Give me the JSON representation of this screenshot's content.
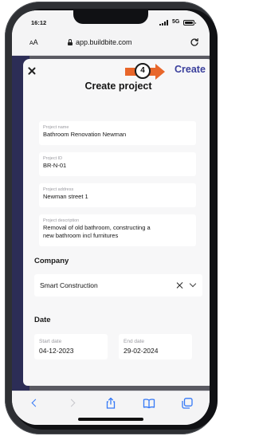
{
  "status_bar": {
    "time": "16:12",
    "network": "5G"
  },
  "browser": {
    "text_size_label_small": "A",
    "text_size_label_large": "A",
    "url": "app.buildbite.com"
  },
  "modal": {
    "step_number": "4",
    "create_label": "Create",
    "title": "Create project",
    "fields": {
      "project_name": {
        "label": "Project name",
        "value": "Bathroom Renovation Newman"
      },
      "project_id": {
        "label": "Project ID",
        "value": "BR-N-01"
      },
      "project_address": {
        "label": "Project address",
        "value": "Newman street 1"
      },
      "project_description": {
        "label": "Project description",
        "value_line1": "Removal of old bathroom, constructing a",
        "value_line2": "new bathroom incl furnitures"
      }
    },
    "company": {
      "heading": "Company",
      "selected": "Smart Construction"
    },
    "date": {
      "heading": "Date",
      "start_label": "Start date",
      "start_value": "04-12-2023",
      "end_label": "End date",
      "end_value": "29-02-2024"
    }
  },
  "colors": {
    "accent": "#3a3f9c",
    "callout": "#e8662a",
    "ios_blue": "#3478f6"
  },
  "toolbar_icons": [
    "back-icon",
    "forward-icon",
    "share-icon",
    "bookmarks-icon",
    "tabs-icon"
  ]
}
